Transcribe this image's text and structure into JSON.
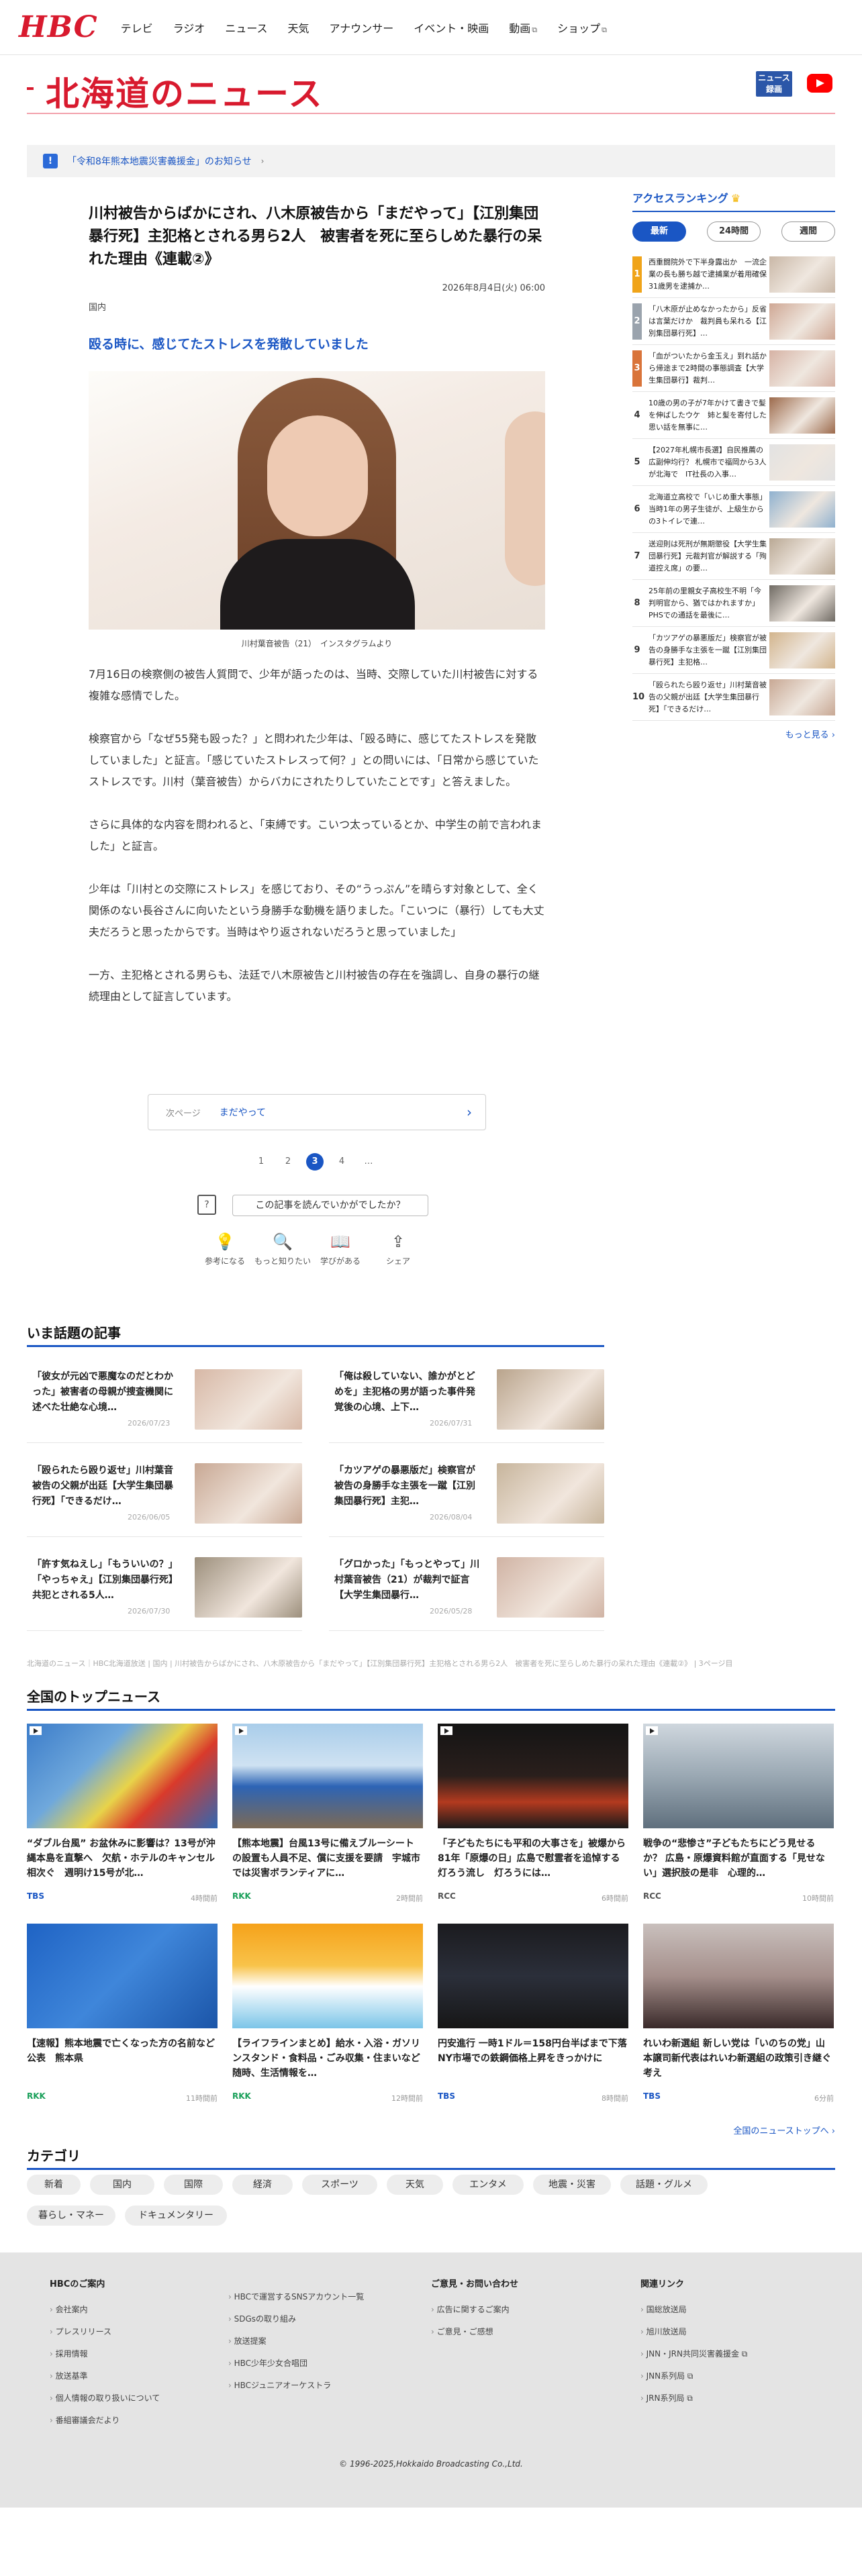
{
  "header": {
    "logo": "HBC",
    "nav": [
      "テレビ",
      "ラジオ",
      "ニュース",
      "天気",
      "アナウンサー",
      "イベント・映画",
      "動画",
      "ショップ"
    ],
    "nav_external_marks": [
      "",
      "",
      "",
      "",
      "",
      "",
      "⧉",
      "⧉"
    ]
  },
  "brand": {
    "site_title": "北海道のニュース",
    "news_badge": "ニュース\n録画"
  },
  "notice": {
    "text": "「令和8年熊本地震災害義援金」のお知らせ"
  },
  "article": {
    "title": "川村被告からばかにされ、八木原被告から「まだやって」【江別集団暴行死】主犯格とされる男ら2人　被害者を死に至らしめた暴行の呆れた理由《連載②》",
    "date": "2026年8月4日(火) 06:00",
    "category": "国内",
    "lead": "殴る時に、感じてたストレスを発散していました",
    "photo_caption": "川村葉音被告（21）　インスタグラムより",
    "paragraphs": [
      "7月16日の検察側の被告人質問で、少年が語ったのは、当時、交際していた川村被告に対する複雑な感情でした。",
      "検察官から「なぜ55発も殴った？」と問われた少年は、「殴る時に、感じてたストレスを発散していました」と証言。「感じていたストレスって何？」との問いには、「日常から感じていたストレスです。川村（葉音被告）からバカにされたりしていたことです」と答えました。",
      "さらに具体的な内容を問われると、「束縛です。こいつ太っているとか、中学生の前で言われました」と証言。",
      "少年は「川村との交際にストレス」を感じており、その“うっぷん”を晴らす対象として、全く関係のない長谷さんに向いたという身勝手な動機を語りました。「こいつに（暴行）しても大丈夫だろうと思ったからです。当時はやり返されないだろうと思っていました」",
      "一方、主犯格とされる男らも、法廷で八木原被告と川村被告の存在を強調し、自身の暴行の継続理由として証言しています。"
    ],
    "next_label": "次ページ",
    "next_title": "まだやって",
    "pages": [
      "1",
      "2",
      "3",
      "4",
      "…"
    ],
    "current_page": "3",
    "feedback_question": "この記事を読んでいかがでしたか？",
    "reactions": [
      {
        "icon": "💡",
        "label": "参考になる"
      },
      {
        "icon": "🔍",
        "label": "もっと知りたい"
      },
      {
        "icon": "📖",
        "label": "学びがある"
      },
      {
        "icon": "⇪",
        "label": "シェア"
      }
    ]
  },
  "trending": {
    "heading": "いま話題の記事",
    "items": [
      {
        "title": "「彼女が元凶で悪魔なのだとわかった」被害者の母親が捜査機関に述べた壮絶な心境…",
        "date": "2026/07/23",
        "thumb": "#d7b8a6"
      },
      {
        "title": "「俺は殺していない、誰かがとどめを」主犯格の男が語った事件発覚後の心境、上下…",
        "date": "2026/07/31",
        "thumb": "#b9a48c"
      },
      {
        "title": "「殴られたら殴り返せ」川村葉音被告の父親が出廷【大学生集団暴行死】「できるだけ…",
        "date": "2026/06/05",
        "thumb": "#c8a894"
      },
      {
        "title": "「カツアゲの暴悪版だ」検察官が被告の身勝手な主張を一蹴【江別集団暴行死】主犯…",
        "date": "2026/08/04",
        "thumb": "#c7b59c"
      },
      {
        "title": "「許す気ねえし」「もういいの？」「やっちゃえ」【江別集団暴行死】共犯とされる5人…",
        "date": "2026/07/30",
        "thumb": "#9c8f7c"
      },
      {
        "title": "「グロかった」「もっとやって」川村葉音被告（21）が裁判で証言【大学生集団暴行…",
        "date": "2026/05/28",
        "thumb": "#d0b3a4"
      }
    ]
  },
  "breadcrumb": "北海道のニュース｜HBC北海道放送 | 国内 | 川村被告からばかにされ、八木原被告から「まだやって」【江別集団暴行死】主犯格とされる男ら2人　被害者を死に至らしめた暴行の呆れた理由《連載②》 | 3ページ目",
  "top_news": {
    "heading": "全国のトップニュース",
    "items": [
      {
        "title": "“ダブル台風” お盆休みに影響は？13号が沖縄本島を直撃へ　欠航・ホテルのキャンセル相次ぐ　週明け15号が北…",
        "source": "TBS",
        "time": "4時間前",
        "src_color": "#1a56c4",
        "img": "linear-gradient(135deg,#3b7cc9 0%,#6fa8dc 35%,#e8d34a 55%,#d93a2b 70%,#2f67b3 100%)"
      },
      {
        "title": "【熊本地震】台風13号に備えブルーシートの設置も人員不足、償に支援を要請　宇城市では災害ボランティアに…",
        "source": "RKK",
        "time": "2時間前",
        "src_color": "#1aa05a",
        "img": "linear-gradient(180deg,#a9cdea 0%,#cfe2f2 40%,#2d64b5 60%,#7d6a55 100%)"
      },
      {
        "title": "「子どもたちにも平和の大事さを」被爆から81年「原爆の日」広島で慰霊者を追悼する灯ろう流し　灯ろうには…",
        "source": "RCC",
        "time": "6時間前",
        "src_color": "#555",
        "img": "linear-gradient(180deg,#141414 0%,#2a1f1c 50%,#b33a1f 75%,#1a1a1a 100%)"
      },
      {
        "title": "戦争の“悲惨さ”子どもたちにどう見せるか？ 広島・原爆資料館が直面する「見せない」選択肢の是非　心理的…",
        "source": "RCC",
        "time": "10時間前",
        "src_color": "#555",
        "img": "linear-gradient(180deg,#cfd7de 0%,#9aa8b3 50%,#5f6f7d 100%)"
      },
      {
        "title": "【速報】熊本地震で亡くなった方の名前など公表　熊本県",
        "source": "RKK",
        "time": "11時間前",
        "src_color": "#1aa05a",
        "img": "linear-gradient(135deg,#1f63c4 0%,#3f86da 50%,#1b55a8 100%)"
      },
      {
        "title": "【ライフラインまとめ】給水・入浴・ガソリンスタンド・食料品・ごみ収集・住まいなど　随時、生活情報を…",
        "source": "RKK",
        "time": "12時間前",
        "src_color": "#1aa05a",
        "img": "linear-gradient(180deg,#f6a21a 0%,#f8c34a 40%,#ffffff 60%,#7cc5e8 100%)"
      },
      {
        "title": "円安進行 一時1ドル＝158円台半ばまで下落　NY市場での鉄鋼価格上昇をきっかけに",
        "source": "TBS",
        "time": "8時間前",
        "src_color": "#1a56c4",
        "img": "linear-gradient(180deg,#1b1b1f 0%,#2b2f3a 50%,#161616 100%)"
      },
      {
        "title": "れいわ新選組 新しい党は「いのちの党」山本譲司新代表はれいわ新選組の政策引き継ぐ考え",
        "source": "TBS",
        "time": "6分前",
        "src_color": "#1a56c4",
        "img": "linear-gradient(180deg,#c9c0bd 0%,#a58f8b 50%,#3a2a2a 100%)"
      }
    ],
    "more": "全国のニューストップへ ›"
  },
  "categories": {
    "heading": "カテゴリ",
    "items": [
      "新着",
      "国内",
      "国際",
      "経済",
      "スポーツ",
      "天気",
      "エンタメ",
      "地震・災害",
      "話題・グルメ",
      "暮らし・マネー",
      "ドキュメンタリー"
    ]
  },
  "ranking": {
    "heading": "アクセスランキング",
    "tabs": [
      "最新",
      "24時間",
      "週間"
    ],
    "active_tab": "最新",
    "items": [
      {
        "n": "1",
        "title": "西重闘院外で下半身露出か　一流企業の長も勝ち越で逮捕業が着用確保　31歳男を逮捕か…",
        "thumb": "#c9b7a6"
      },
      {
        "n": "2",
        "title": "「八木原が止めなかったから」反省は言葉だけか　裁判員も呆れる【江別集団暴行死】…",
        "thumb": "#cfa794"
      },
      {
        "n": "3",
        "title": "「血がついたから金玉え」到れ話から帰途まで2時間の事態調査【大学生集団暴行】裁判…",
        "thumb": "#d6b2a4"
      },
      {
        "n": "4",
        "title": "10歳の男の子が7年かけて書きで髪を伸ばしたウケ　姉と髪を寄付した思い話を無事に…",
        "thumb": "#9c6a4c"
      },
      {
        "n": "5",
        "title": "【2027年札幌市長選】自民推薦の広副伸均行？ 札幌市で福岡から3人が北海で　IT社長の入事…",
        "thumb": "#e2e2e2"
      },
      {
        "n": "6",
        "title": "北海道立高校で「いじめ重大事態」　当時1年の男子生徒が、上級生からの3トイレで連…",
        "thumb": "#8fb1cf"
      },
      {
        "n": "7",
        "title": "送迎則は死刑が無期懲役【大学生集団暴行死】元裁判官が解説する「殉道控え席」の要…",
        "thumb": "#b9a894"
      },
      {
        "n": "8",
        "title": "25年前の里親女子高校生不明「今判明官から、猶ではかれますか」PHSでの通話を最後に…",
        "thumb": "#6f6a63"
      },
      {
        "n": "9",
        "title": "「カツアゲの暴悪版だ」検察官が被告の身勝手な主張を一蹴【江別集団暴行死】主犯格…",
        "thumb": "#d2b48c"
      },
      {
        "n": "10",
        "title": "「殴られたら殴り返せ」川村葉音被告の父親が出廷【大学生集団暴行死】「できるだけ…",
        "thumb": "#c8a894"
      }
    ],
    "more": "もっと見る ›"
  },
  "footer": {
    "cols": [
      {
        "heading": "HBCのご案内",
        "links": [
          "会社案内",
          "プレスリリース",
          "採用情報",
          "放送基準",
          "個人情報の取り扱いについて",
          "番組審議会だより"
        ]
      },
      {
        "heading": "",
        "links": [
          "HBCで運営するSNSアカウント一覧",
          "SDGsの取り組み",
          "放送提案",
          "HBC少年少女合唱団",
          "HBCジュニアオーケストラ"
        ]
      },
      {
        "heading": "ご意見・お問い合わせ",
        "links": [
          "広告に関するご案内",
          "ご意見・ご感想"
        ]
      },
      {
        "heading": "関連リンク",
        "links": [
          "国総放送局",
          "旭川放送局",
          "JNN・JRN共同災害義援金 ⧉",
          "JNN系列局 ⧉",
          "JRN系列局 ⧉"
        ]
      }
    ],
    "copyright": "© 1996-2025,Hokkaido Broadcasting Co.,Ltd."
  }
}
